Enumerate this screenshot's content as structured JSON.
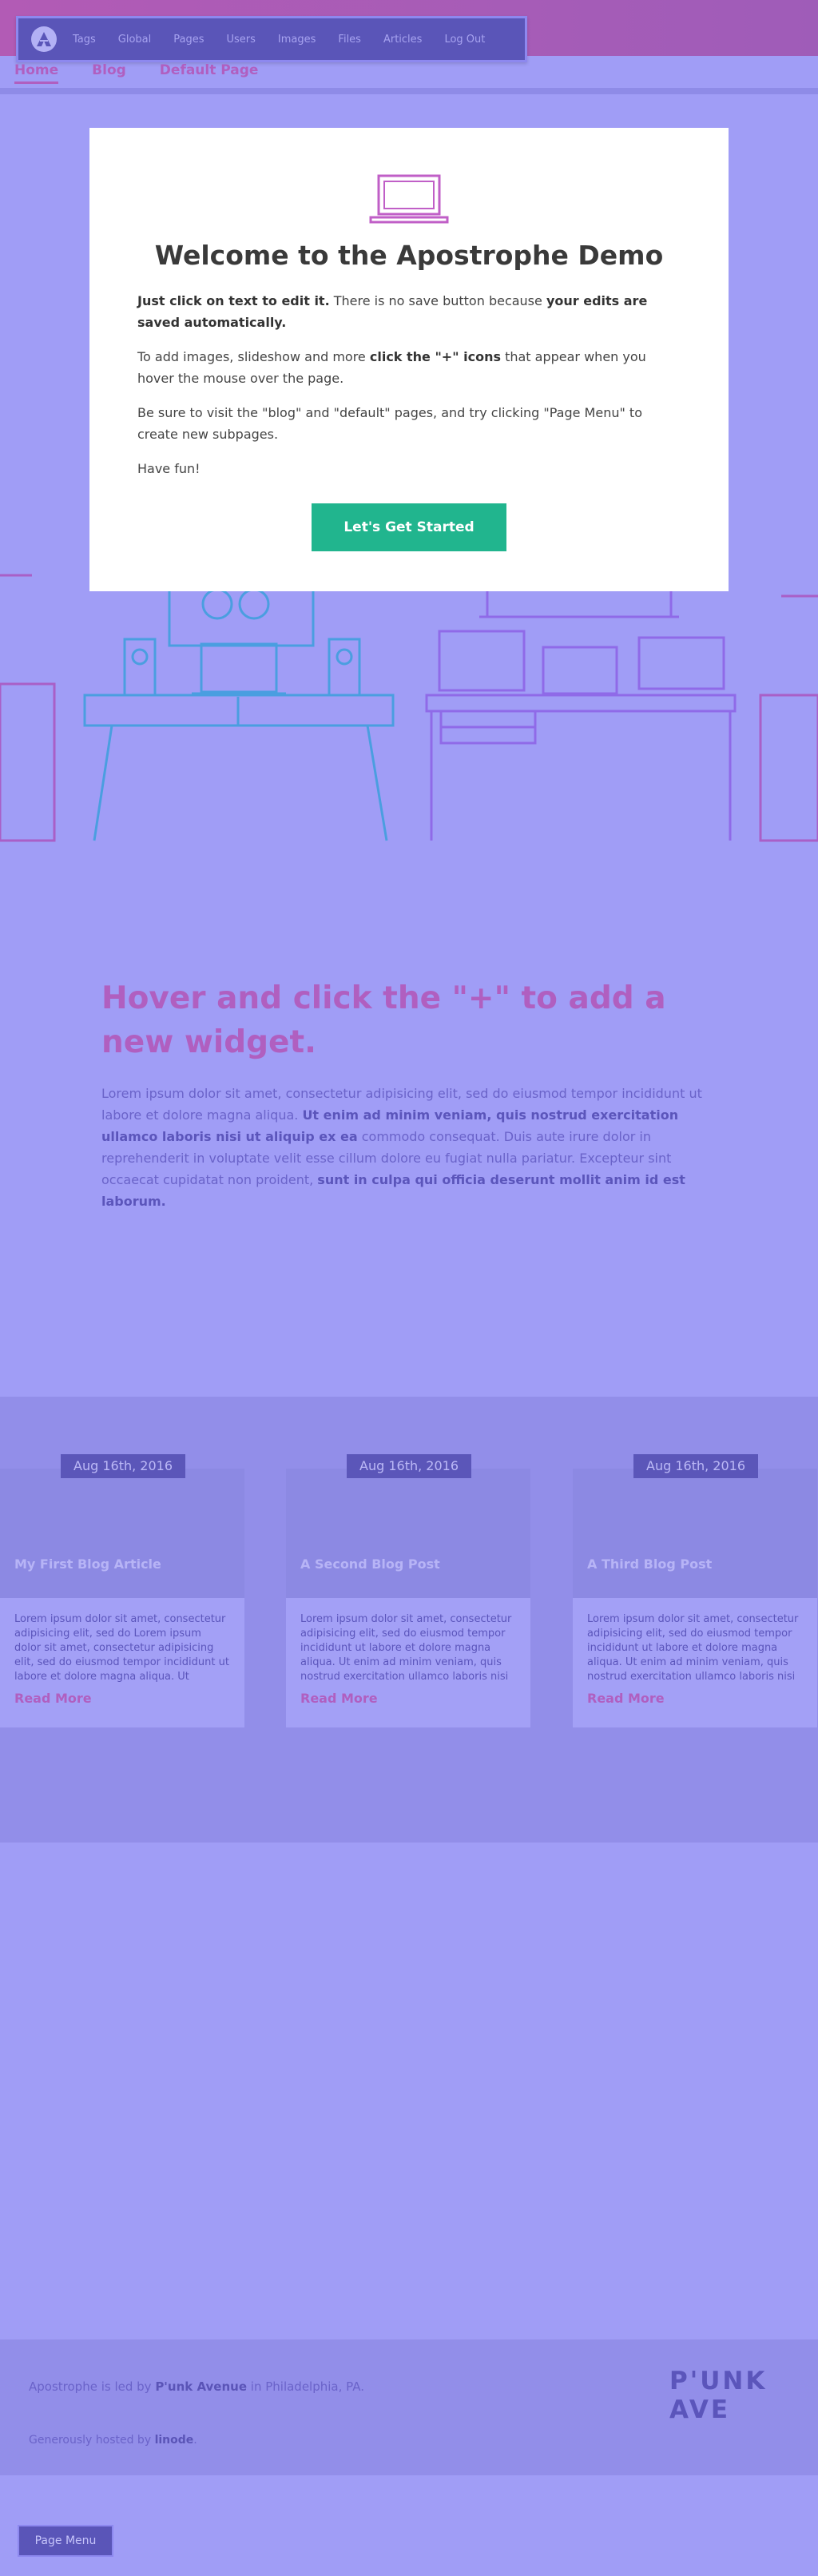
{
  "admin_bar": {
    "items": [
      "Tags",
      "Global",
      "Pages",
      "Users",
      "Images",
      "Files",
      "Articles",
      "Log Out"
    ]
  },
  "nav": {
    "links": [
      "Home",
      "Blog",
      "Default Page"
    ],
    "active": "Home"
  },
  "welcome": {
    "title": "Welcome to the Apostrophe Demo",
    "p1": {
      "bold1": "Just click on text to edit it.",
      "text1": " There is no save button because ",
      "bold2": "your edits are saved automatically."
    },
    "p2": {
      "text1": "To add images, slideshow and more ",
      "bold": "click the \"+\" icons",
      "text2": " that appear when you hover the mouse over the page."
    },
    "p3": "Be sure to visit the \"blog\" and \"default\" pages, and try clicking \"Page Menu\" to create new subpages.",
    "p4": "Have fun!",
    "button": "Let's Get Started"
  },
  "widget": {
    "heading": "Hover and click the \"+\" to add a new widget.",
    "text1": "Lorem ipsum dolor sit amet, consectetur adipisicing elit, sed do eiusmod tempor incididunt ut labore et dolore magna aliqua. ",
    "bold1": "Ut enim ad minim veniam, quis nostrud exercitation ullamco laboris nisi ut aliquip ex ea",
    "text2": " commodo consequat. Duis aute irure dolor in reprehenderit in voluptate velit esse cillum dolore eu fugiat nulla pariatur. Excepteur sint occaecat cupidatat non proident, ",
    "bold2": "sunt in culpa qui officia deserunt mollit anim id est laborum."
  },
  "posts": [
    {
      "date": "Aug 16th, 2016",
      "title": "My First Blog Article",
      "excerpt": "Lorem ipsum dolor sit amet, consectetur adipisicing elit, sed do   Lorem ipsum dolor sit amet, consectetur adipisicing elit, sed do eiusmod tempor incididunt ut labore et dolore magna aliqua. Ut",
      "more": "Read More"
    },
    {
      "date": "Aug 16th, 2016",
      "title": "A Second Blog Post",
      "excerpt": "Lorem ipsum dolor sit amet, consectetur adipisicing elit, sed do eiusmod tempor incididunt ut labore et dolore magna aliqua. Ut enim ad minim veniam, quis nostrud exercitation ullamco laboris nisi",
      "more": "Read More"
    },
    {
      "date": "Aug 16th, 2016",
      "title": "A Third Blog Post",
      "excerpt": "Lorem ipsum dolor sit amet, consectetur adipisicing elit, sed do eiusmod tempor incididunt ut labore et dolore magna aliqua. Ut enim ad minim veniam, quis nostrud exercitation ullamco laboris nisi",
      "more": "Read More"
    }
  ],
  "footer": {
    "l1a": "Apostrophe is led by ",
    "l1b": "P'unk Avenue",
    "l1c": " in Philadelphia, PA.",
    "l2a": "Generously hosted by ",
    "l2b": "linode",
    "l2c": ".",
    "brand": "P'UNK AVE"
  },
  "page_menu": "Page Menu",
  "colors": {
    "accent": "#b05fc0",
    "cta": "#21b58e",
    "bar": "#5a55b8",
    "background": "#a09df6"
  }
}
